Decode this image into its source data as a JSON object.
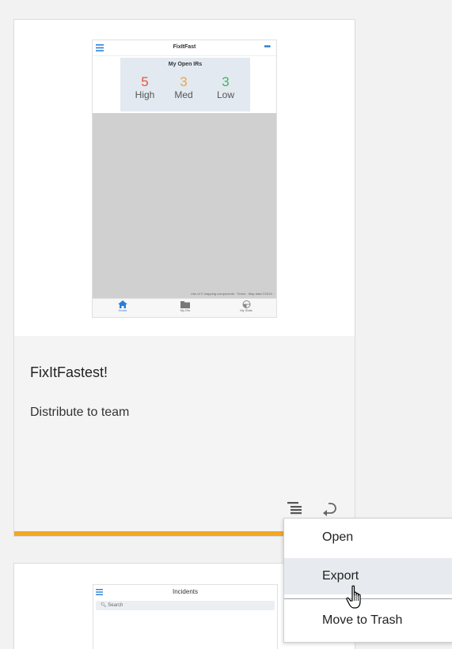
{
  "card1": {
    "title": "FixItFastest!",
    "description": "Distribute to team",
    "accent_color": "#f5a623",
    "thumbnail": {
      "app_title": "FixItFast",
      "counts_title": "My Open IRs",
      "counts": [
        {
          "value": "5",
          "label": "High",
          "color": "#e8533b"
        },
        {
          "value": "3",
          "label": "Med",
          "color": "#f0a830"
        },
        {
          "value": "3",
          "label": "Low",
          "color": "#3cb85a"
        }
      ],
      "map_attribution": "Use of © mapping components · Terms · Map data ©2015 ·",
      "tabs": [
        {
          "label": "Home",
          "icon": "home-icon",
          "active": true
        },
        {
          "label": "My IRs",
          "icon": "folder-icon",
          "active": false
        },
        {
          "label": "My Stats",
          "icon": "chart-icon",
          "active": false
        }
      ]
    }
  },
  "card2": {
    "thumbnail": {
      "app_title": "Incidents",
      "search_placeholder": "Search"
    }
  },
  "context_menu": {
    "items": [
      {
        "label": "Open",
        "hover": false
      },
      {
        "label": "Export",
        "hover": true
      },
      {
        "label": "Move to Trash",
        "hover": false
      }
    ]
  }
}
